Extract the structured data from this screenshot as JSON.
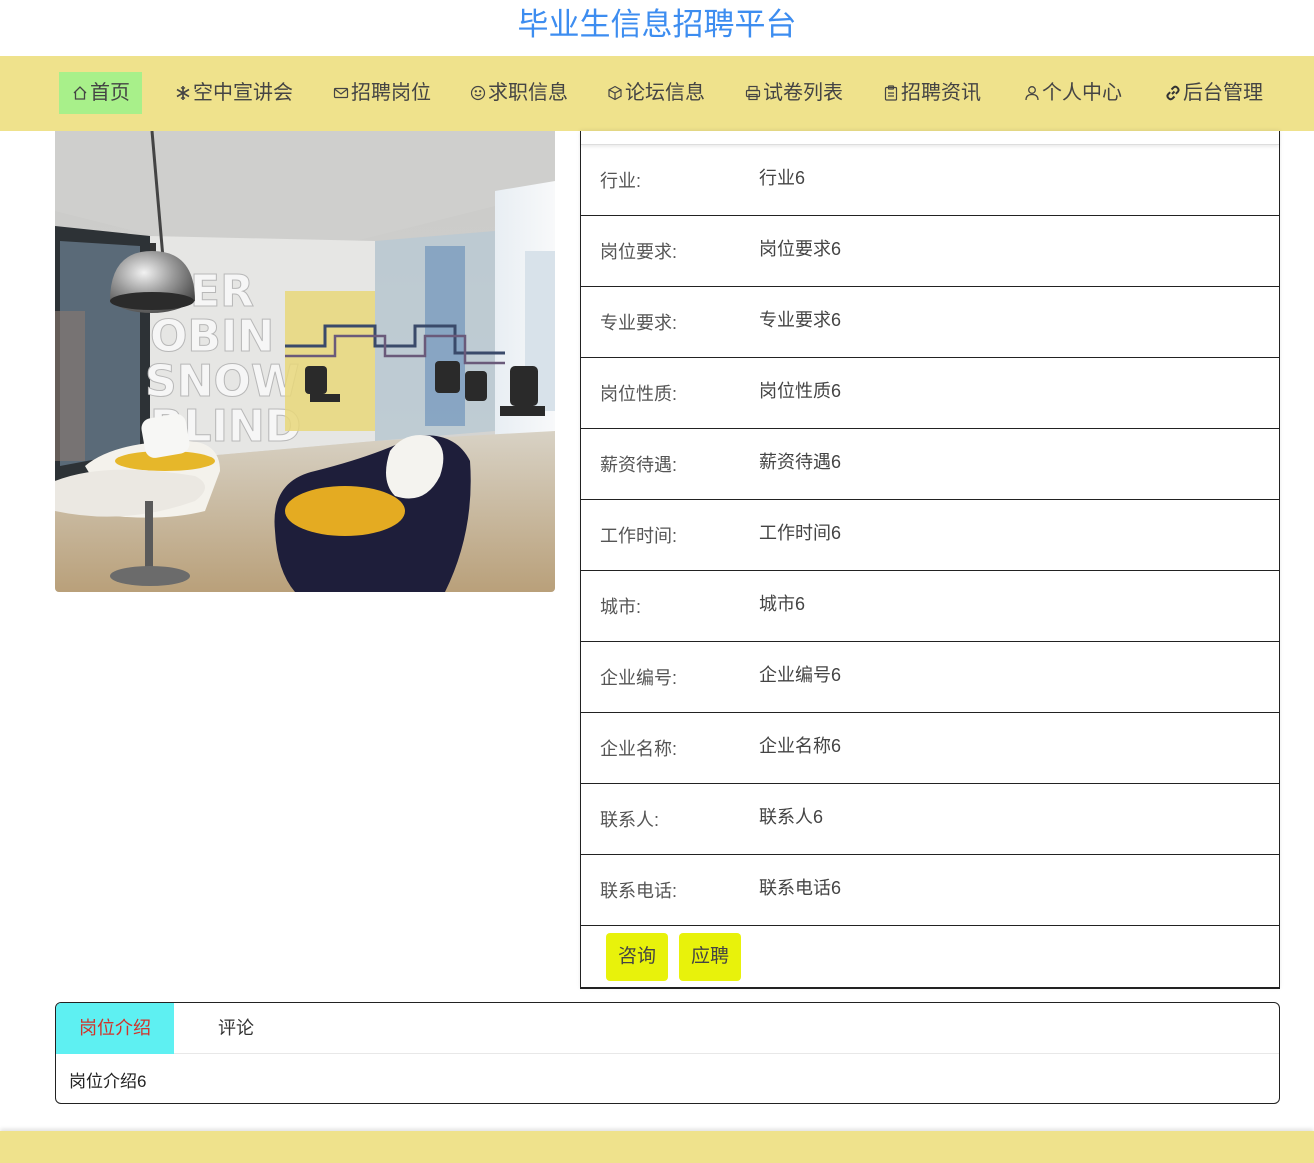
{
  "site": {
    "title": "毕业生信息招聘平台"
  },
  "nav": {
    "items": [
      {
        "label": "首页",
        "icon": "home-icon"
      },
      {
        "label": "空中宣讲会",
        "icon": "snowflake-icon"
      },
      {
        "label": "招聘岗位",
        "icon": "mail-icon"
      },
      {
        "label": "求职信息",
        "icon": "smile-icon"
      },
      {
        "label": "论坛信息",
        "icon": "cube-icon"
      },
      {
        "label": "试卷列表",
        "icon": "printer-icon"
      },
      {
        "label": "招聘资讯",
        "icon": "clipboard-icon"
      },
      {
        "label": "个人中心",
        "icon": "user-icon"
      },
      {
        "label": "后台管理",
        "icon": "link-icon"
      }
    ],
    "active_index": 0,
    "active_color": "#a8f08a",
    "bar_color": "#efe28c"
  },
  "photo": {
    "icon": "office-interior-image"
  },
  "details": [
    {
      "label": "行业:",
      "value": "行业6"
    },
    {
      "label": "岗位要求:",
      "value": "岗位要求6"
    },
    {
      "label": "专业要求:",
      "value": "专业要求6"
    },
    {
      "label": "岗位性质:",
      "value": "岗位性质6"
    },
    {
      "label": "薪资待遇:",
      "value": "薪资待遇6"
    },
    {
      "label": "工作时间:",
      "value": "工作时间6"
    },
    {
      "label": "城市:",
      "value": "城市6"
    },
    {
      "label": "企业编号:",
      "value": "企业编号6"
    },
    {
      "label": "企业名称:",
      "value": "企业名称6"
    },
    {
      "label": "联系人:",
      "value": "联系人6"
    },
    {
      "label": "联系电话:",
      "value": "联系电话6"
    }
  ],
  "actions": {
    "consult": "咨询",
    "apply": "应聘",
    "button_color": "#e8f20b"
  },
  "tabs": {
    "items": [
      "岗位介绍",
      "评论"
    ],
    "active_index": 0,
    "active_color": "#5ef0f2",
    "content": "岗位介绍6"
  }
}
